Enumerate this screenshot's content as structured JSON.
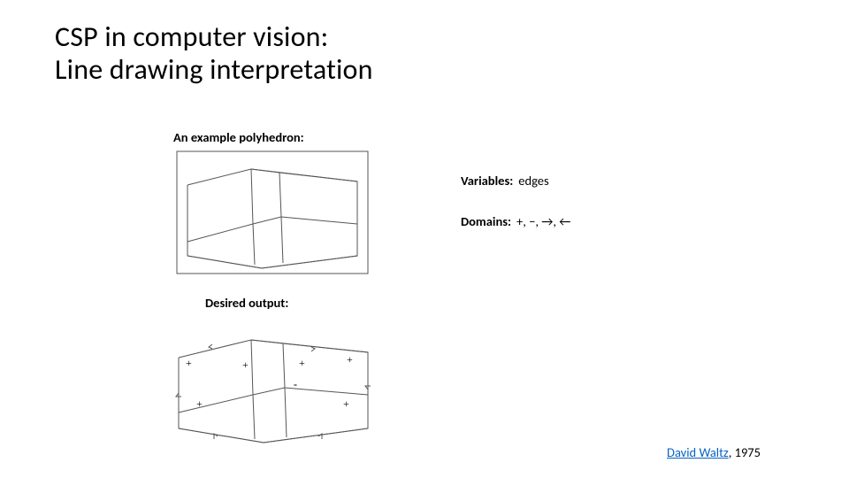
{
  "title": {
    "line1": "CSP in computer vision:",
    "line2": "Line drawing interpretation"
  },
  "captions": {
    "example": "An example polyhedron:",
    "desired": "Desired output:"
  },
  "rhs": {
    "variables_label": "Variables:",
    "variables_value": "edges",
    "domains_label": "Domains:",
    "domains_value": "+, −, →, ←"
  },
  "citation": {
    "author": "David Waltz",
    "year_suffix": ", 1975"
  },
  "labels": {
    "top_plus": [
      "+",
      "+",
      "+",
      "+"
    ],
    "mid_minus": "-",
    "side_plus": [
      "+",
      "+"
    ]
  }
}
